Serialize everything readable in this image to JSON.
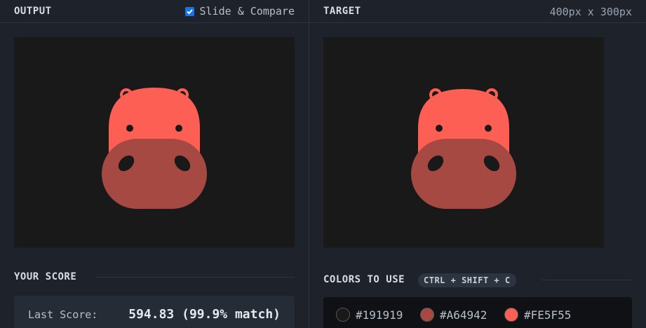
{
  "left": {
    "title": "OUTPUT",
    "compare_label": "Slide & Compare",
    "compare_checked": true,
    "score_section_title": "YOUR SCORE",
    "last_score_label": "Last Score:",
    "last_score_value": "594.83 (99.9% match)"
  },
  "right": {
    "title": "TARGET",
    "dimensions": "400px x 300px",
    "colors_title": "COLORS TO USE",
    "shortcut": "CTRL + SHIFT + C",
    "colors": [
      {
        "hex": "#191919",
        "label": "#191919"
      },
      {
        "hex": "#A64942",
        "label": "#A64942"
      },
      {
        "hex": "#FE5F55",
        "label": "#FE5F55"
      }
    ]
  }
}
